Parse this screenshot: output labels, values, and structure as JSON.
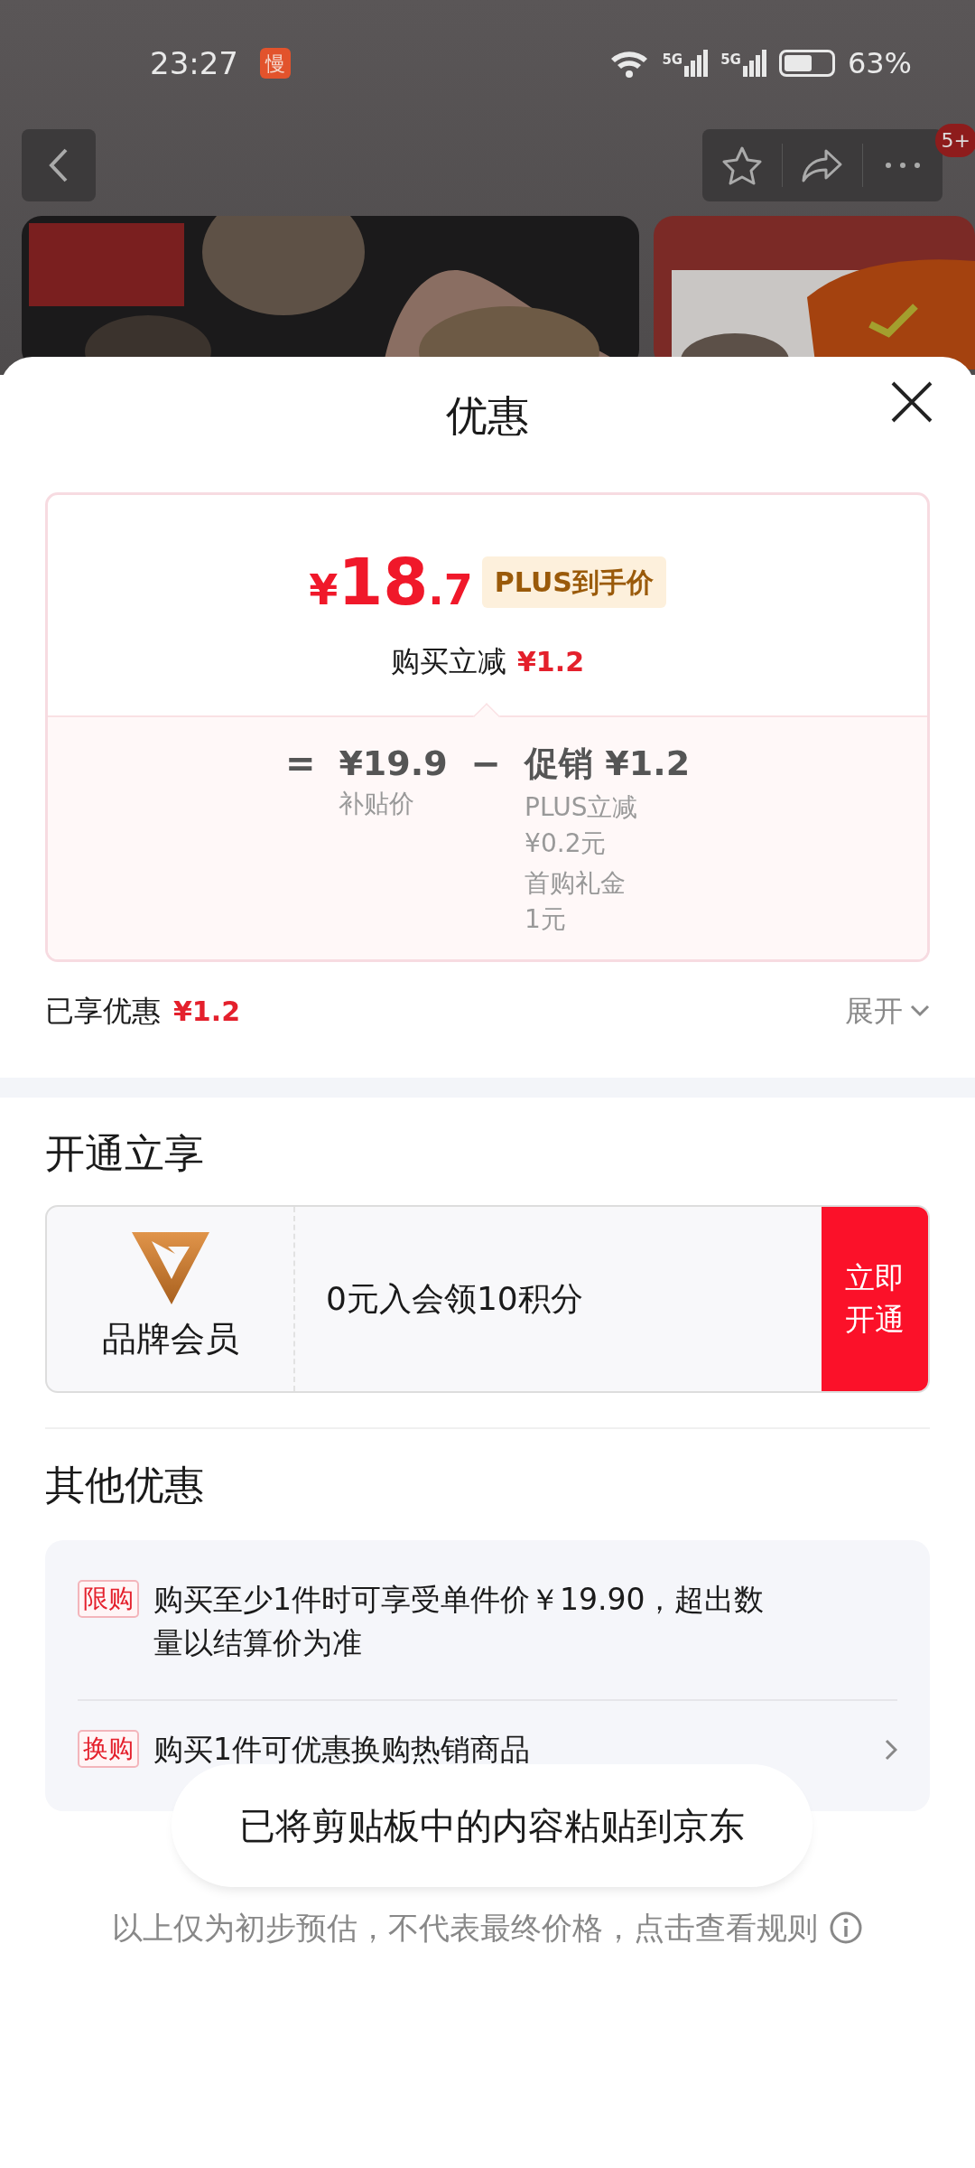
{
  "status_bar": {
    "time": "23:27",
    "app_badge": "慢",
    "networks": [
      "5G",
      "5G"
    ],
    "battery": "63%"
  },
  "top_bar": {
    "notification_count": "5+"
  },
  "sheet": {
    "title": "优惠",
    "price_card": {
      "currency": "¥",
      "price_int": "18",
      "price_dec": ".7",
      "tag": "PLUS到手价",
      "reduction_label": "购买立减",
      "reduction_value": "¥1.2",
      "breakdown": {
        "equals": "=",
        "base_price": "¥19.9",
        "base_label": "补贴价",
        "minus": "−",
        "promo_title": "促销 ¥1.2",
        "promo_items": [
          {
            "name": "PLUS立减",
            "amount": "¥0.2元"
          },
          {
            "name": "首购礼金",
            "amount": "1元"
          }
        ]
      }
    },
    "enjoyed": {
      "label": "已享优惠",
      "value": "¥1.2",
      "expand": "展开"
    },
    "open_section": {
      "heading": "开通立享",
      "membership": {
        "name": "品牌会员",
        "offer": "0元入会领10积分",
        "button": "立即开通"
      }
    },
    "other_section": {
      "heading": "其他优惠",
      "offers": [
        {
          "tag": "限购",
          "text": "购买至少1件时可享受单件价￥19.90，超出数量以结算价为准",
          "has_arrow": false
        },
        {
          "tag": "换购",
          "text": "购买1件可优惠换购热销商品",
          "has_arrow": true
        }
      ]
    },
    "footer_note": "以上仅为初步预估，不代表最终价格，点击查看规则"
  },
  "toast": "已将剪贴板中的内容粘贴到京东"
}
